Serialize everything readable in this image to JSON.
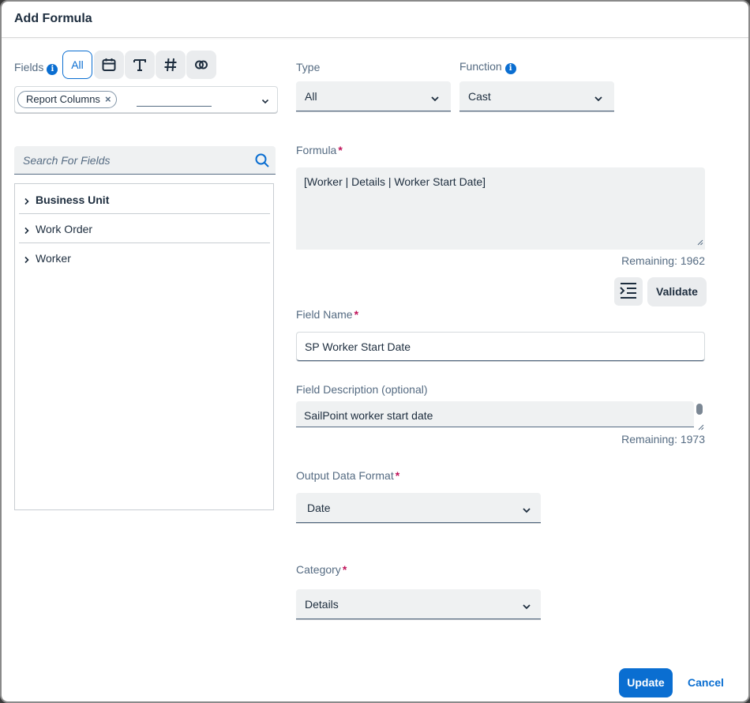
{
  "dialog": {
    "title": "Add Formula"
  },
  "fields_panel": {
    "label": "Fields",
    "info_icon": "info-icon",
    "toggles": [
      {
        "label": "All",
        "icon": "",
        "selected": true
      },
      {
        "label": "",
        "icon": "calendar-icon",
        "selected": false
      },
      {
        "label": "",
        "icon": "text-type-icon",
        "selected": false
      },
      {
        "label": "",
        "icon": "number-hash-icon",
        "selected": false
      },
      {
        "label": "",
        "icon": "boolean-rings-icon",
        "selected": false
      }
    ],
    "token": {
      "label": "Report Columns",
      "remove_glyph": "×"
    },
    "search": {
      "placeholder": "Search For Fields"
    },
    "tree": [
      {
        "label": "Business Unit"
      },
      {
        "label": "Work Order"
      },
      {
        "label": "Worker"
      }
    ]
  },
  "form": {
    "type": {
      "label": "Type",
      "value": "All"
    },
    "function": {
      "label": "Function",
      "value": "Cast"
    },
    "formula": {
      "label": "Formula",
      "value": "[Worker | Details | Worker Start Date]",
      "remaining": "Remaining: 1962"
    },
    "validate_label": "Validate",
    "field_name": {
      "label": "Field Name",
      "value": "SP Worker Start Date"
    },
    "field_description": {
      "label": "Field Description (optional)",
      "value": "SailPoint worker start date",
      "remaining": "Remaining: 1973"
    },
    "output_format": {
      "label": "Output Data Format",
      "value": "Date"
    },
    "category": {
      "label": "Category",
      "value": "Details"
    },
    "required_marker": "*"
  },
  "footer": {
    "update_label": "Update",
    "cancel_label": "Cancel"
  },
  "colors": {
    "accent": "#0a6ed1",
    "required": "#c0135a",
    "text": "#1d2d3e",
    "muted": "#556b82"
  }
}
